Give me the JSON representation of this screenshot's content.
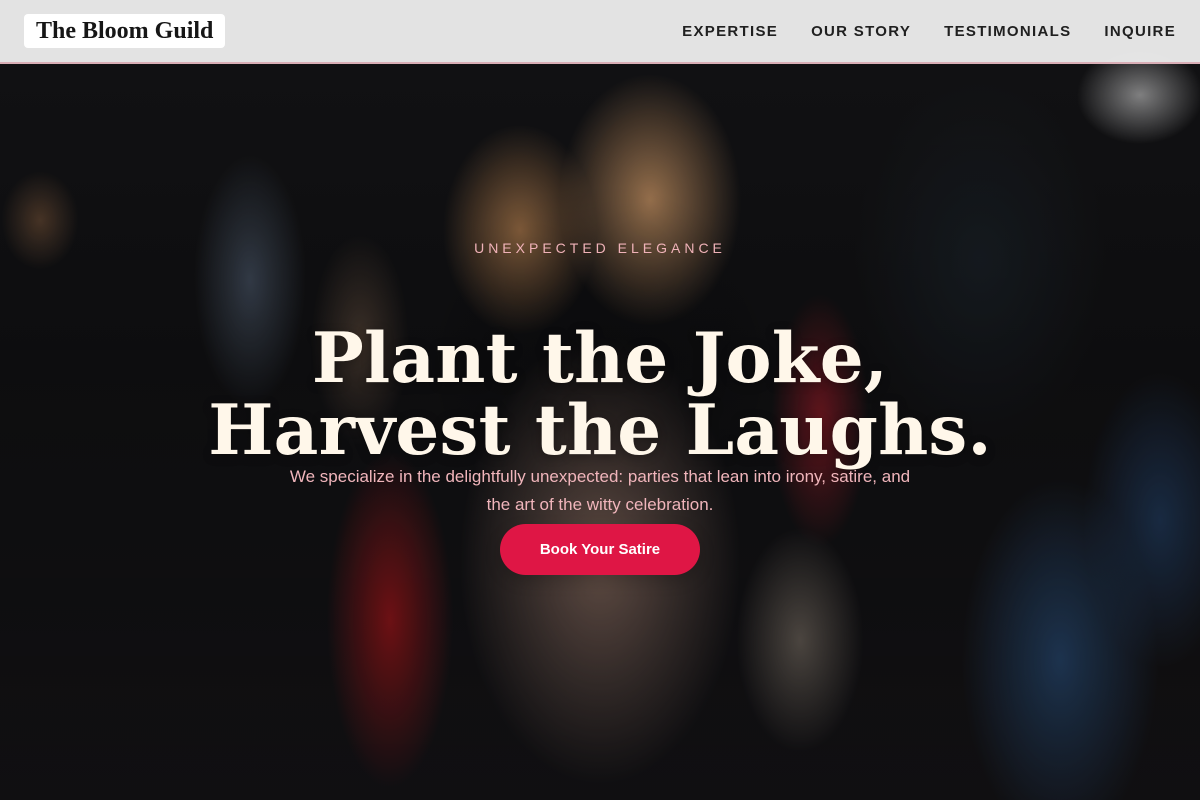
{
  "brand": {
    "name": "The Bloom Guild"
  },
  "nav": {
    "items": [
      {
        "label": "EXPERTISE"
      },
      {
        "label": "OUR STORY"
      },
      {
        "label": "TESTIMONIALS"
      },
      {
        "label": "INQUIRE"
      }
    ]
  },
  "hero": {
    "eyebrow": "UNEXPECTED ELEGANCE",
    "headline": {
      "line1": "Plant the Joke,",
      "line2": "Harvest the Laughs."
    },
    "subtitle": {
      "line1": "We specialize in the delightfully unexpected: parties that lean into irony, satire, and",
      "line2": "the art of the witty celebration."
    },
    "cta_label": "Book Your Satire"
  },
  "colors": {
    "nav_bg": "#f0f0f0",
    "nav_border": "#d9aeb6",
    "accent": "#df1645",
    "headline": "#fff7ea",
    "eyebrow": "#efb2b8"
  }
}
